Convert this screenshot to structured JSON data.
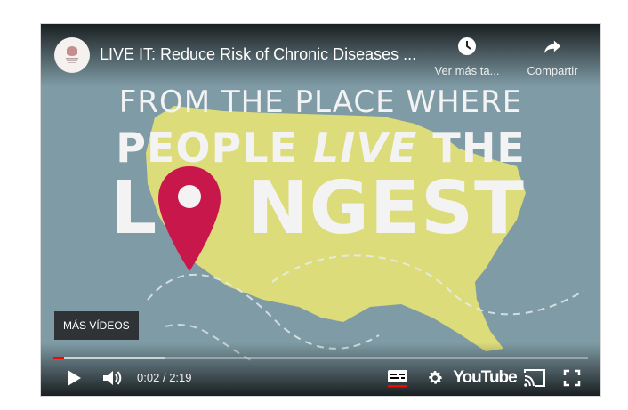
{
  "player": {
    "title": "LIVE IT: Reduce Risk of Chronic Diseases ...",
    "watch_later_label": "Ver más ta...",
    "share_label": "Compartir",
    "more_videos_label": "MÁS VÍDEOS",
    "current_time": "0:02",
    "time_separator": "/",
    "duration": "2:19",
    "progress_played_fraction": 0.02,
    "progress_loaded_fraction": 0.21,
    "youtube_logo": "YouTube"
  },
  "video_frame": {
    "line1": "FROM THE PLACE WHERE",
    "line2_a": "PEOPLE ",
    "line2_b": "LIVE",
    "line2_c": " THE",
    "line3_a": "L",
    "line3_b": "NGEST"
  },
  "icons": {
    "watch_later": "clock-icon",
    "share": "share-arrow-icon",
    "play": "play-icon",
    "volume": "volume-icon",
    "subtitles": "subtitles-icon",
    "settings": "gear-icon",
    "cast": "cast-icon",
    "fullscreen": "fullscreen-icon",
    "pin": "map-pin-icon"
  },
  "colors": {
    "video_bg": "#7e9aa4",
    "map_fill": "#dcdc7a",
    "pin": "#c8174a",
    "progress_played": "#ff0000",
    "subtitles_underline": "#ff0000"
  }
}
